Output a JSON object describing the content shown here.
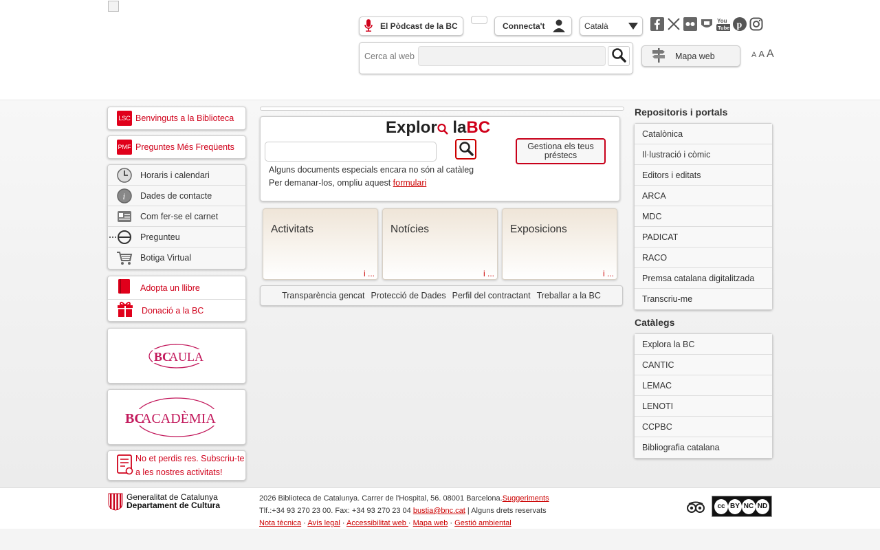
{
  "header": {
    "podcast_label": "El Pòdcast de la BC",
    "connect_label": "Connecta't",
    "language_selected": "Català",
    "search_label": "Cerca al web",
    "mapa_web_label": "Mapa web",
    "font_sizes": [
      "A",
      "A",
      "A"
    ],
    "social_icons": [
      "facebook-icon",
      "x-icon",
      "flickr-icon",
      "untappd-icon",
      "youtube-icon",
      "pinterest-icon",
      "instagram-icon"
    ]
  },
  "left": {
    "lsc_tag": "LSC",
    "benvinguts_label": "Benvinguts a la Biblioteca",
    "pmf_tag": "PMF",
    "preguntes_label": "Preguntes Més Freqüents",
    "info_items": [
      {
        "label": "Horaris i calendari",
        "icon": "clock-icon"
      },
      {
        "label": "Dades de contacte",
        "icon": "info-icon"
      },
      {
        "label": "Com fer-se el carnet",
        "icon": "card-icon"
      },
      {
        "label": "Pregunteu",
        "icon": "ask-icon"
      },
      {
        "label": "Botiga Virtual",
        "icon": "cart-icon"
      }
    ],
    "adopta_label": "Adopta un llibre",
    "donacio_label": "Donació a la BC",
    "aula_prefix": "BC",
    "aula_label": "AULA",
    "academia_prefix": "BC",
    "academia_label": "ACADÈMIA",
    "subscriu_line1": "No et perdis res. Subscriu-te",
    "subscriu_line2": "a les nostres activitats!"
  },
  "center": {
    "explora_word1": "Explor",
    "explora_word2": "la",
    "explora_word3": "BC",
    "gestiona_label": "Gestiona els teus préstecs",
    "note_line1": "Alguns documents especials encara no són al catàleg",
    "note_line2": "Per demanar-los, ompliu aquest ",
    "note_link": "formulari",
    "cards": [
      {
        "title": "Activitats",
        "more": "i ..."
      },
      {
        "title": "Notícies",
        "more": "i ..."
      },
      {
        "title": "Exposicions",
        "more": "i ..."
      }
    ],
    "links": [
      "Transparència gencat",
      "Protecció de Dades",
      "Perfil del contractant",
      "Treballar a la BC"
    ]
  },
  "right": {
    "repositoris_title": "Repositoris i portals",
    "repositoris": [
      "Catalònica",
      "Il·lustració i còmic",
      "Editors i editats",
      "ARCA",
      "MDC",
      "PADICAT",
      "RACO",
      "Premsa catalana digitalitzada",
      "Transcriu-me"
    ],
    "catalegs_title": "Catàlegs",
    "catalegs": [
      "Explora la BC",
      "CANTIC",
      "LEMAC",
      "LENOTI",
      "CCPBC",
      "Bibliografia catalana"
    ]
  },
  "footer": {
    "gen_line1": "Generalitat de Catalunya",
    "gen_line2": "Departament de Cultura",
    "address": "2026 Biblioteca de Catalunya. Carrer de l'Hospital, 56. 08001 Barcelona.",
    "suggeriments": "Suggeriments",
    "phone": "Tlf.:+34 93 270 23 00. Fax: +34 93 270 23 04 ",
    "email": "bustia@bnc.cat",
    "rights": " | Alguns drets reservats",
    "links": [
      "Nota tècnica",
      "Avís legal",
      "Accessibilitat web ",
      "Mapa web",
      "Gestió ambiental"
    ],
    "cc_labels": [
      "cc",
      "BY",
      "NC",
      "ND"
    ]
  },
  "colors": {
    "brand_red": "#d0001a",
    "text": "#333333"
  }
}
